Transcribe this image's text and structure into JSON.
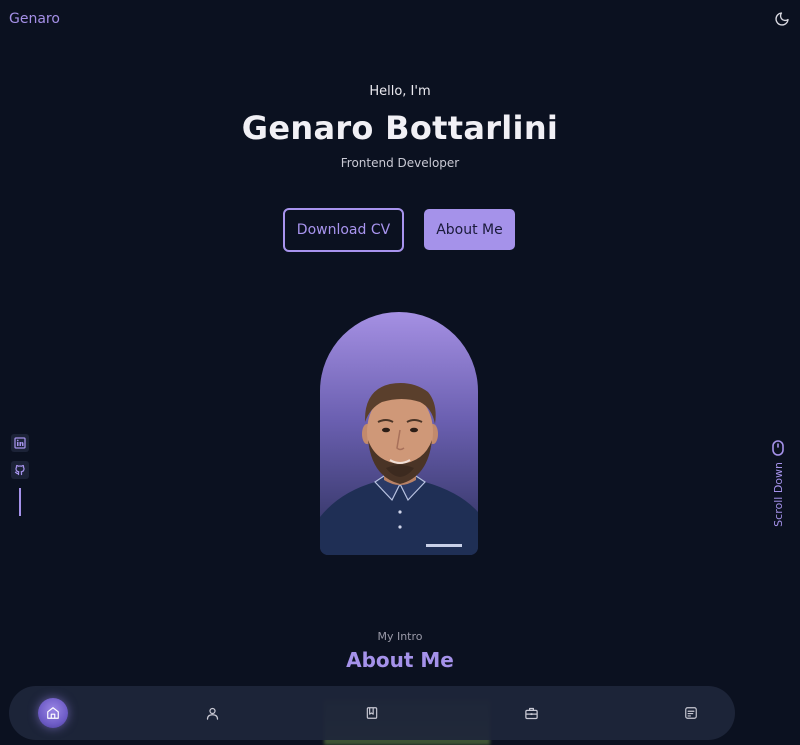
{
  "header": {
    "logo": "Genaro",
    "theme_icon": "moon-icon"
  },
  "hero": {
    "greeting": "Hello, I'm",
    "name": "Genaro Bottarlini",
    "role": "Frontend Developer",
    "download_cv_label": "Download CV",
    "about_me_label": "About Me"
  },
  "socials": [
    {
      "icon": "linkedin-icon"
    },
    {
      "icon": "github-icon"
    }
  ],
  "scroll": {
    "label": "Scroll Down",
    "icon": "mouse-icon"
  },
  "intro": {
    "subtitle": "My Intro",
    "title": "About Me"
  },
  "nav": {
    "items": [
      {
        "icon": "home-icon",
        "active": true
      },
      {
        "icon": "user-icon",
        "active": false
      },
      {
        "icon": "book-icon",
        "active": false
      },
      {
        "icon": "briefcase-icon",
        "active": false
      },
      {
        "icon": "message-icon",
        "active": false
      }
    ]
  },
  "colors": {
    "background": "#0b1120",
    "accent": "#a592ea",
    "navbar": "#1e263a"
  }
}
